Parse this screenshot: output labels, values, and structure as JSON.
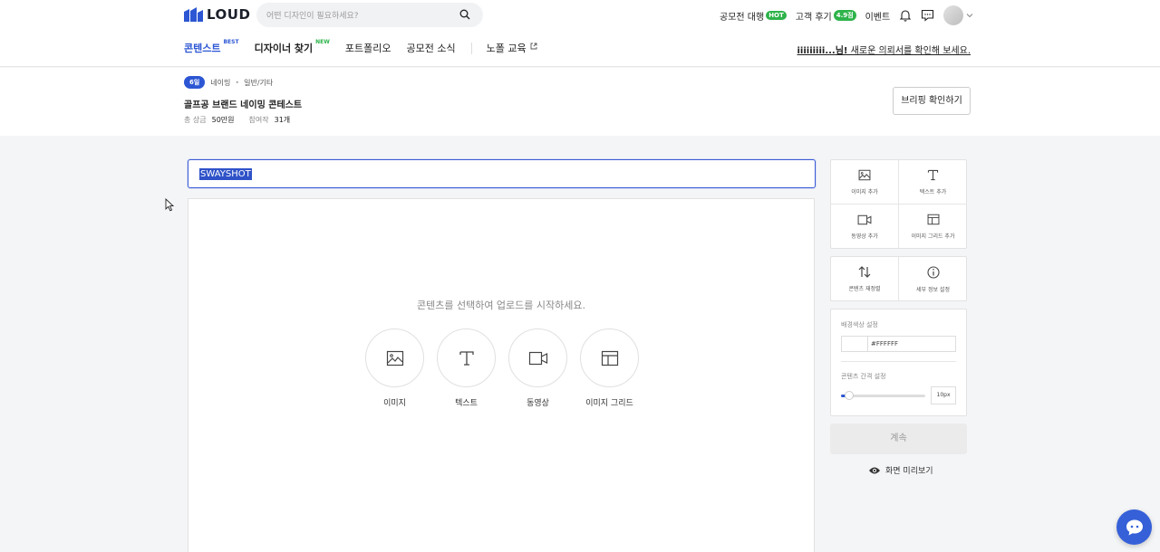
{
  "header": {
    "logo_text": "LOUD",
    "search_placeholder": "어떤 디자인이 필요하세요?",
    "links": [
      {
        "label": "공모전 대행",
        "badge": "HOT"
      },
      {
        "label": "고객 후기",
        "badge": "4.9점"
      },
      {
        "label": "이벤트"
      }
    ],
    "icons": [
      "bell-icon",
      "chat-icon",
      "avatar",
      "chevron-down-icon"
    ]
  },
  "nav": {
    "items": [
      {
        "label": "콘텐스트",
        "sup": "BEST"
      },
      {
        "label": "디자이너 찾기",
        "sup": "NEW"
      },
      {
        "label": "포트폴리오"
      },
      {
        "label": "공모전 소식"
      },
      {
        "label": "노폴 교육"
      }
    ],
    "notice_name": "iiiiiiiii...님!",
    "notice_text": " 새로운 의뢰서를 확인해 보세요."
  },
  "contest": {
    "dday": "6일",
    "category1": "네이밍",
    "category2": "일반/기타",
    "title": "골프공 브랜드 네이밍 콘테스트",
    "prize_label": "총 상금",
    "prize_value": "50만원",
    "entries_label": "참여작",
    "entries_value": "31개",
    "brief_button": "브리핑 확인하기"
  },
  "editor": {
    "title_value": "SWAYSHOT",
    "hint": "콘텐츠를 선택하여 업로드를 시작하세요.",
    "options": [
      {
        "label": "이미지",
        "icon": "image-icon"
      },
      {
        "label": "텍스트",
        "icon": "text-icon"
      },
      {
        "label": "동영상",
        "icon": "video-icon"
      },
      {
        "label": "이미지 그리드",
        "icon": "grid-icon"
      }
    ]
  },
  "panel": {
    "add_items": [
      {
        "label": "이미지 추가",
        "icon": "image-icon"
      },
      {
        "label": "텍스트 추가",
        "icon": "text-icon"
      },
      {
        "label": "동영상 추가",
        "icon": "video-icon"
      },
      {
        "label": "이미지 그리드 추가",
        "icon": "grid-icon"
      }
    ],
    "tools": [
      {
        "label": "콘텐츠 재정렬",
        "icon": "reorder-icon"
      },
      {
        "label": "세부 정보 설정",
        "icon": "info-icon"
      }
    ],
    "bg_color_label": "배경색상 설정",
    "bg_color_value": "#FFFFFF",
    "spacing_label": "콘텐츠 간격 설정",
    "spacing_value": "10px",
    "spacing_fraction": 0.1,
    "continue_button": "계속",
    "preview_label": "화면 미리보기"
  },
  "colors": {
    "accent": "#2c56d3",
    "badge_green": "#2db34a",
    "fab": "#3560d8"
  }
}
